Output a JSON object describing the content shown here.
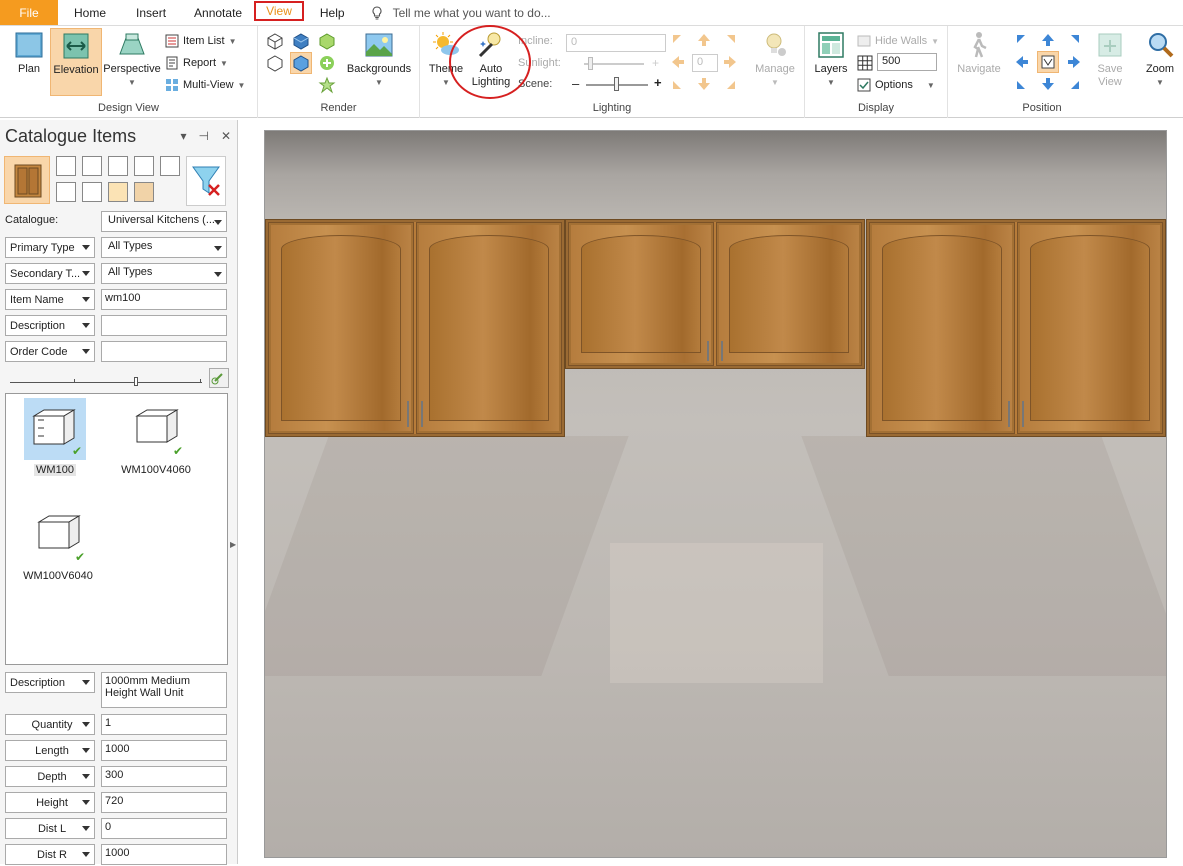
{
  "menu": {
    "file": "File",
    "items": [
      "Home",
      "Insert",
      "Annotate",
      "View",
      "Help"
    ],
    "tell_me": "Tell me what you want to do..."
  },
  "ribbon": {
    "design_view": {
      "label": "Design View",
      "plan": "Plan",
      "elevation": "Elevation",
      "perspective": "Perspective",
      "item_list": "Item List",
      "report": "Report",
      "multi_view": "Multi-View"
    },
    "render": {
      "label": "Render",
      "backgrounds": "Backgrounds"
    },
    "lighting": {
      "label": "Lighting",
      "theme": "Theme",
      "auto_lighting_1": "Auto",
      "auto_lighting_2": "Lighting",
      "incline_label": "Incline:",
      "incline_value": "0",
      "sunlight_label": "Sunlight:",
      "sunlight_value": "0",
      "scene_label": "Scene:",
      "minus": "–",
      "plus": "+",
      "manage": "Manage"
    },
    "display": {
      "label": "Display",
      "layers": "Layers",
      "hide_walls": "Hide Walls",
      "grid_value": "500",
      "options": "Options"
    },
    "position": {
      "label": "Position",
      "navigate": "Navigate",
      "save_view_1": "Save",
      "save_view_2": "View",
      "zoom": "Zoom"
    }
  },
  "panel": {
    "title": "Catalogue Items",
    "pin": "⊣",
    "close": "✕",
    "catalogue_label": "Catalogue:",
    "catalogue_value": "Universal Kitchens (...",
    "filters": [
      {
        "label": "Primary Type",
        "value": "All Types"
      },
      {
        "label": "Secondary T...",
        "value": "All Types"
      },
      {
        "label": "Item Name",
        "value": "wm100"
      },
      {
        "label": "Description",
        "value": ""
      },
      {
        "label": "Order Code",
        "value": ""
      }
    ],
    "items": [
      {
        "name": "WM100"
      },
      {
        "name": "WM100V4060"
      },
      {
        "name": "WM100V6040"
      }
    ],
    "properties": [
      {
        "label": "Description",
        "value": "1000mm Medium Height Wall Unit"
      },
      {
        "label": "Quantity",
        "value": "1"
      },
      {
        "label": "Length",
        "value": "1000"
      },
      {
        "label": "Depth",
        "value": "300"
      },
      {
        "label": "Height",
        "value": "720"
      },
      {
        "label": "Dist L",
        "value": "0"
      },
      {
        "label": "Dist R",
        "value": "1000"
      }
    ]
  },
  "colors": {
    "accent": "#f59b1f",
    "annotation": "#d62020",
    "selected": "#f9d6aa"
  }
}
